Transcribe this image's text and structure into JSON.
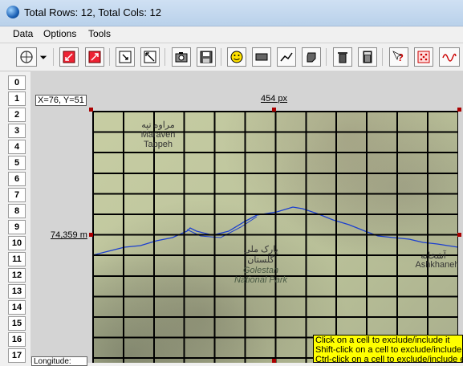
{
  "window": {
    "title": "Total Rows: 12, Total Cols: 12"
  },
  "menu": [
    "Data",
    "Options",
    "Tools"
  ],
  "toolbar_icons": [
    "globe-settings-icon",
    "dropdown-arrow-icon",
    "resize-in-icon",
    "resize-out-icon",
    "select-area-icon",
    "fit-area-icon",
    "camera-icon",
    "save-icon",
    "smiley-icon",
    "rectangle-icon",
    "line-chart-icon",
    "shape-icon",
    "trash-icon",
    "calculator-icon",
    "help-cursor-icon",
    "grid-dots-icon",
    "waveform-icon"
  ],
  "rows": [
    "0",
    "1",
    "2",
    "3",
    "4",
    "5",
    "6",
    "7",
    "8",
    "9",
    "10",
    "11",
    "12",
    "13",
    "14",
    "15",
    "16",
    "17"
  ],
  "map": {
    "coords": "X=76, Y=51",
    "width_label": "454 px",
    "height_label": "74,359 m",
    "places": [
      "مراوه تپه",
      "Maraveh",
      "Tappeh",
      "پارک ملی",
      "گلستان",
      "Golestan",
      "National Park",
      "آشخانه",
      "Ashkhaneh"
    ]
  },
  "tooltip": [
    "Click on a cell to exclude/include it",
    "Shift-click on a cell to exclude/include entire",
    "Ctrl-click on a cell to exclude/include entire"
  ],
  "status": {
    "longitude_label": "Longitude:"
  }
}
